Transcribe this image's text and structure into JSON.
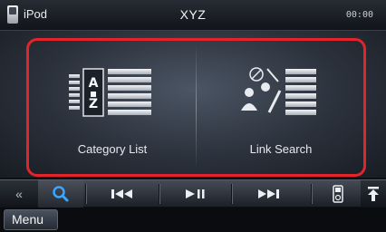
{
  "status_bar": {
    "source": "iPod",
    "title": "XYZ",
    "clock": "00:00",
    "source_icon": "ipod-device-icon"
  },
  "main": {
    "buttons": [
      {
        "label": "Category List",
        "icon": "category-list-icon"
      },
      {
        "label": "Link Search",
        "icon": "link-search-icon"
      }
    ],
    "highlight_color": "#e2242b"
  },
  "control_bar": {
    "back_glyph": "«",
    "items": [
      {
        "name": "back",
        "icon": "double-chevron-left-icon"
      },
      {
        "name": "search",
        "icon": "search-icon"
      },
      {
        "name": "previous",
        "icon": "skip-previous-icon"
      },
      {
        "name": "play-pause",
        "icon": "play-pause-icon"
      },
      {
        "name": "next",
        "icon": "skip-next-icon"
      },
      {
        "name": "device",
        "icon": "ipod-icon"
      },
      {
        "name": "eject",
        "icon": "eject-up-icon"
      }
    ],
    "accent_color": "#3aa6ff"
  },
  "menu_strip": {
    "menu_label": "Menu"
  }
}
